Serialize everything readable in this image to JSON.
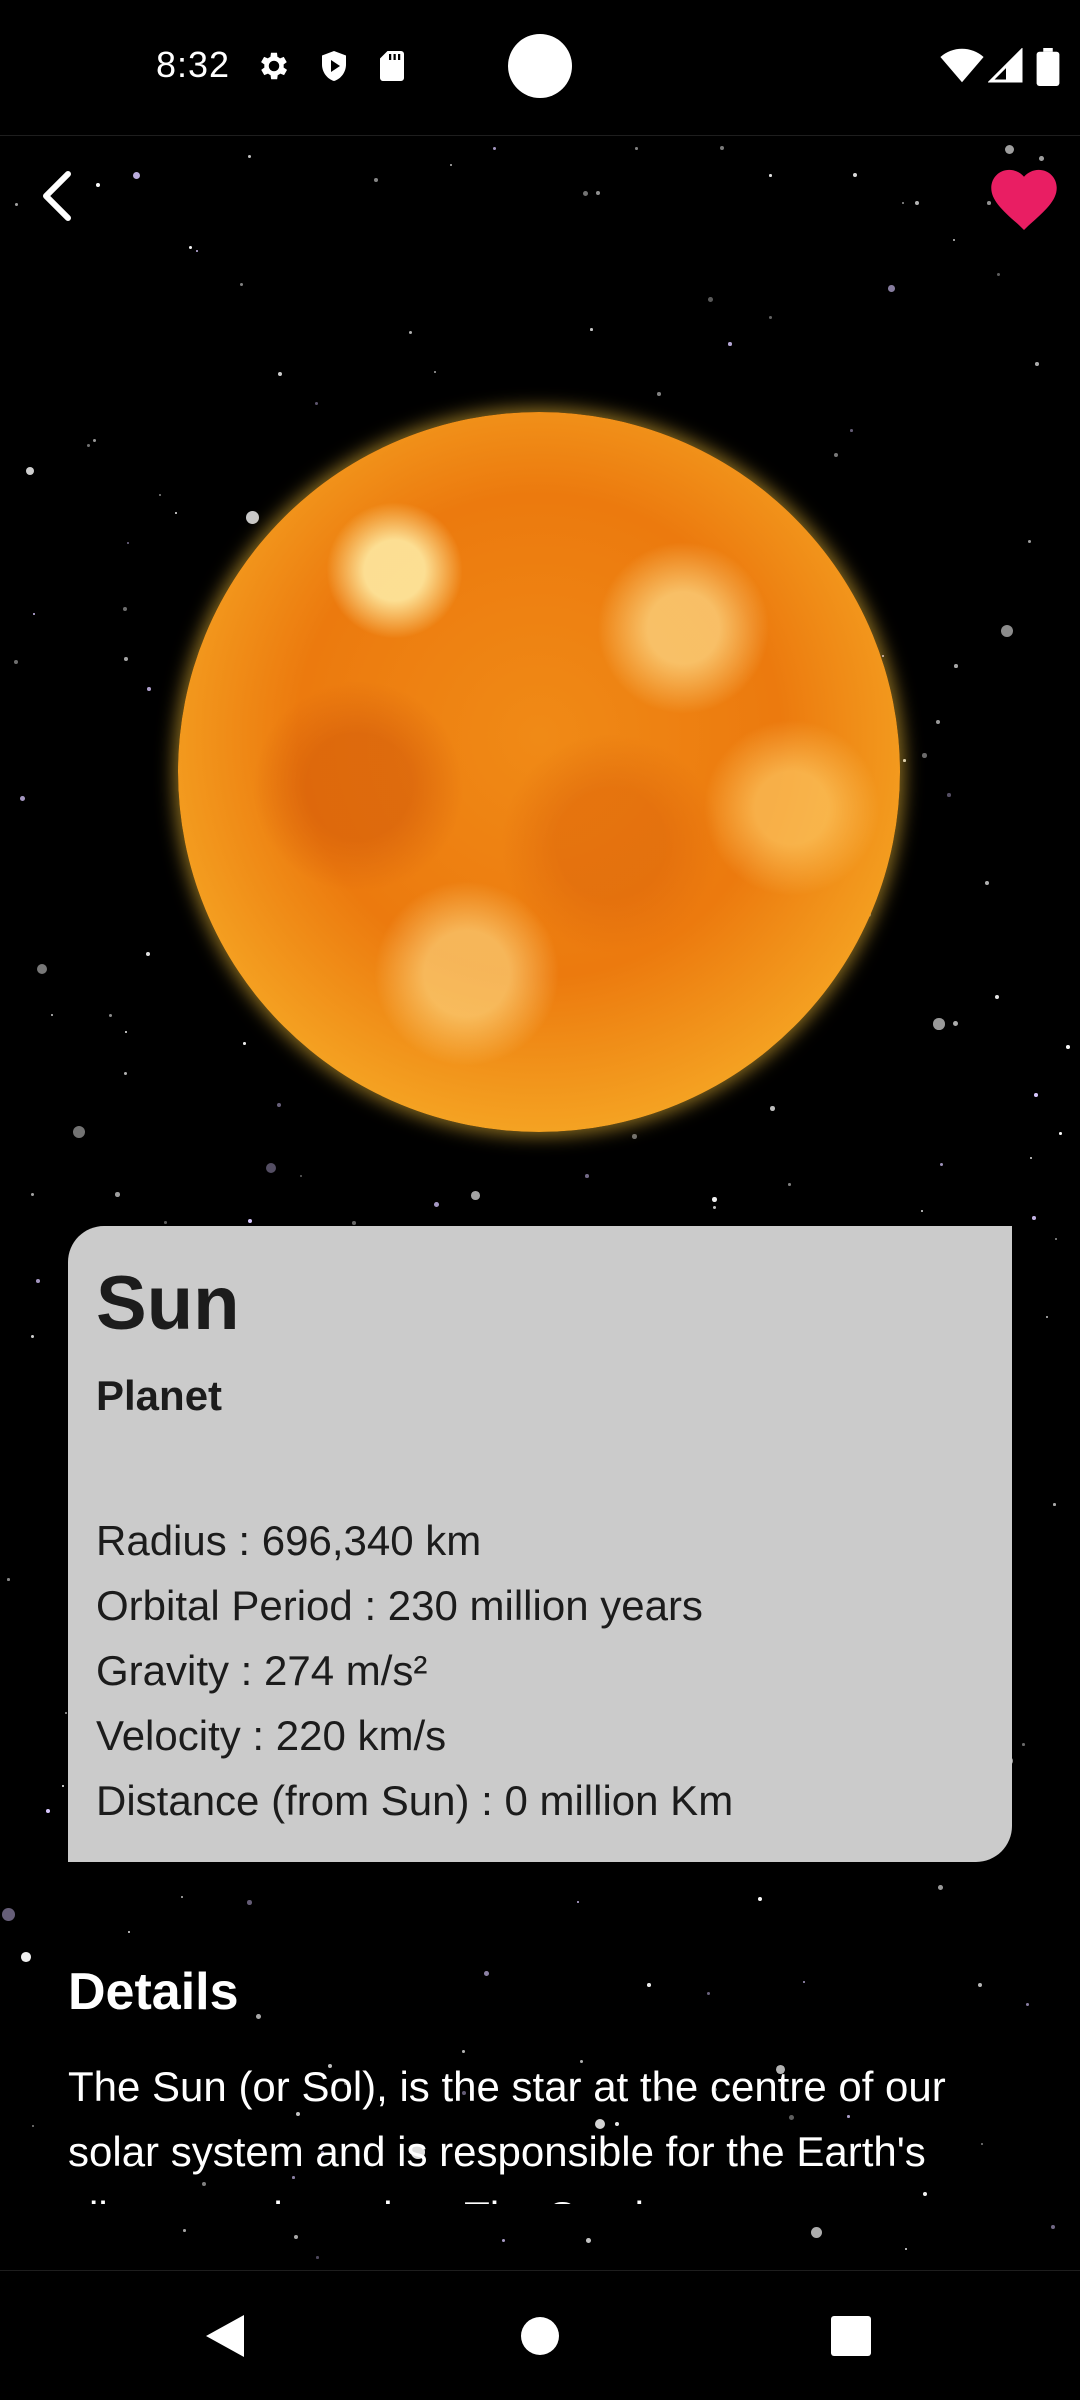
{
  "status_bar": {
    "time": "8:32",
    "left_icons": [
      "gear-icon",
      "play-shield-icon",
      "sd-card-icon"
    ],
    "right_icons": [
      "wifi-icon",
      "signal-icon",
      "battery-icon"
    ]
  },
  "top_bar": {
    "back_icon": "chevron-left-icon",
    "favorite_icon": "heart-icon",
    "favorite_color": "#e91e63",
    "favorited": true
  },
  "colors": {
    "card_background": "#cbcbcb",
    "sun_core": "#ec7a0e",
    "sun_rim": "#ffd54a"
  },
  "body": {
    "name": "Sun",
    "type": "Planet",
    "stats": [
      "Radius : 696,340 km",
      "Orbital Period : 230 million years",
      "Gravity : 274 m/s²",
      "Velocity : 220 km/s",
      "Distance (from Sun) : 0 million Km"
    ]
  },
  "details": {
    "heading": "Details",
    "text": "The Sun (or Sol), is the star at the centre of our solar system and is responsible for the Earth's climate and weather. The Sun is..."
  },
  "nav_bar": {
    "icons": [
      "back-triangle-icon",
      "home-circle-icon",
      "recents-square-icon"
    ]
  }
}
